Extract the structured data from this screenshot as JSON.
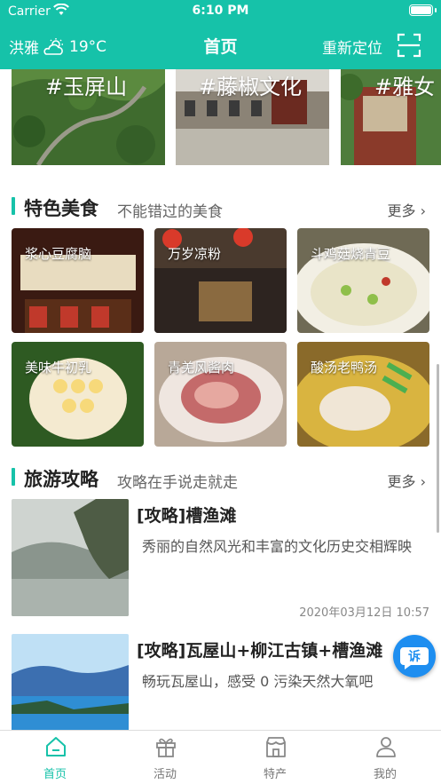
{
  "status_bar": {
    "carrier": "Carrier",
    "time": "6:10 PM"
  },
  "navbar": {
    "city": "洪雅",
    "weather_icon": "cloudy-sun-icon",
    "temperature": "19°C",
    "title": "首页",
    "relocate_label": "重新定位",
    "scan_icon": "scan-icon"
  },
  "banners": [
    {
      "tag": "#玉屏山"
    },
    {
      "tag": "#藤椒文化"
    },
    {
      "tag": "#雅女"
    }
  ],
  "food_section": {
    "title": "特色美食",
    "subtitle": "不能错过的美食",
    "more": "更多",
    "items": [
      {
        "label": "浆心豆腐脑"
      },
      {
        "label": "万岁凉粉"
      },
      {
        "label": "斗鸡菇烧青豆"
      },
      {
        "label": "美味牛初乳"
      },
      {
        "label": "青羌风酱肉"
      },
      {
        "label": "酸汤老鸭汤"
      }
    ]
  },
  "guide_section": {
    "title": "旅游攻略",
    "subtitle": "攻略在手说走就走",
    "more": "更多",
    "articles": [
      {
        "title": "[攻略]槽渔滩",
        "desc": "秀丽的自然风光和丰富的文化历史交相辉映",
        "date": "2020年03月12日 10:57"
      },
      {
        "title": "[攻略]瓦屋山+柳江古镇+槽渔滩",
        "desc": "畅玩瓦屋山，感受 0 污染天然大氧吧"
      }
    ]
  },
  "fab": {
    "label": "诉"
  },
  "tabbar": {
    "tabs": [
      {
        "label": "首页",
        "icon": "home-icon",
        "active": true
      },
      {
        "label": "活动",
        "icon": "gift-icon",
        "active": false
      },
      {
        "label": "特产",
        "icon": "shop-icon",
        "active": false
      },
      {
        "label": "我的",
        "icon": "user-icon",
        "active": false
      }
    ]
  },
  "colors": {
    "primary": "#16c2a9",
    "fab": "#1e8ef0"
  }
}
